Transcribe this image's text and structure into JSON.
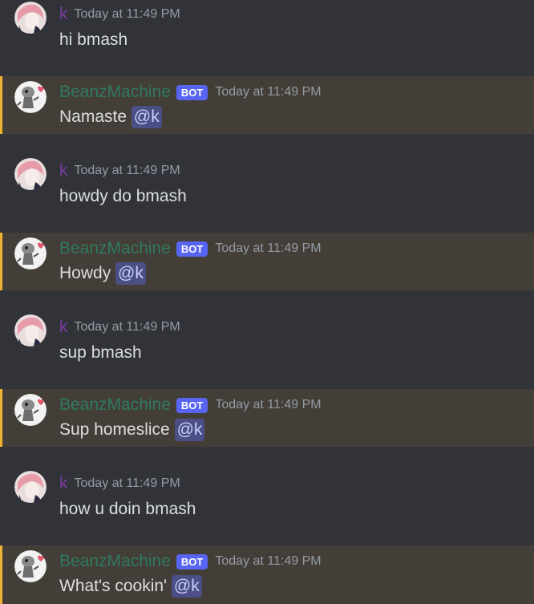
{
  "messages": [
    {
      "author": "k",
      "timestamp": "Today at 11:49 PM",
      "text": "hi bmash"
    },
    {
      "author": "BeanzMachine",
      "bot_tag": "BOT",
      "timestamp": "Today at 11:49 PM",
      "text": "Namaste",
      "mention": "@k"
    },
    {
      "author": "k",
      "timestamp": "Today at 11:49 PM",
      "text": "howdy do bmash"
    },
    {
      "author": "BeanzMachine",
      "bot_tag": "BOT",
      "timestamp": "Today at 11:49 PM",
      "text": "Howdy",
      "mention": "@k"
    },
    {
      "author": "k",
      "timestamp": "Today at 11:49 PM",
      "text": "sup bmash"
    },
    {
      "author": "BeanzMachine",
      "bot_tag": "BOT",
      "timestamp": "Today at 11:49 PM",
      "text": "Sup homeslice",
      "mention": "@k"
    },
    {
      "author": "k",
      "timestamp": "Today at 11:49 PM",
      "text": "how u doin bmash"
    },
    {
      "author": "BeanzMachine",
      "bot_tag": "BOT",
      "timestamp": "Today at 11:49 PM",
      "text": "What's cookin'",
      "mention": "@k"
    }
  ],
  "colors": {
    "background": "#313338",
    "mention_highlight": "#433e37",
    "mention_bar": "#f0b232",
    "user_name": "#7a3ea3",
    "bot_name": "#2f7a5f",
    "bot_tag": "#5865f2",
    "mention_pill": "#4b4f85"
  },
  "icons": {
    "user_avatar": "user-avatar-icon",
    "bot_avatar": "bot-avatar-icon"
  }
}
